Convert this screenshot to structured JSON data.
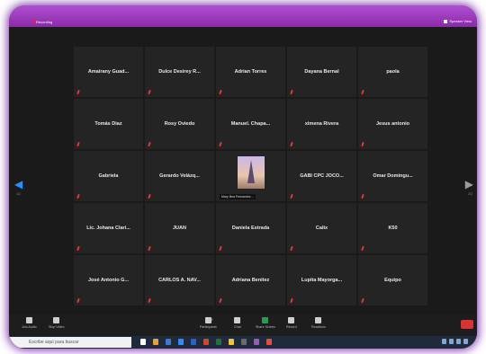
{
  "window": {
    "title": "Recording",
    "speaker_view": "Speaker View"
  },
  "participants": [
    {
      "name": "Amairany  Guad...",
      "muted": true
    },
    {
      "name": "Dulce Desirey R...",
      "muted": true
    },
    {
      "name": "Adrian Torres",
      "muted": true
    },
    {
      "name": "Dayana Bernal",
      "muted": true
    },
    {
      "name": "paola",
      "muted": true
    },
    {
      "name": "Tomás Diaz",
      "muted": true
    },
    {
      "name": "Rosy Oviedo",
      "muted": true
    },
    {
      "name": "Manuel.  Chapa...",
      "muted": true
    },
    {
      "name": "ximena Rivera",
      "muted": true
    },
    {
      "name": "Jesus antonio",
      "muted": true
    },
    {
      "name": "Gabriela",
      "muted": true
    },
    {
      "name": "Gerardo  Velázq...",
      "muted": true
    },
    {
      "name": "Mary Bea Fernandez...",
      "muted": false,
      "photo": true
    },
    {
      "name": "GABI CPC JOCO...",
      "muted": true
    },
    {
      "name": "Omar  Domingu...",
      "muted": true
    },
    {
      "name": "Lic. Johana Clari...",
      "muted": true
    },
    {
      "name": "JUAN",
      "muted": true
    },
    {
      "name": "Daniela Estrada",
      "muted": true
    },
    {
      "name": "Calix",
      "muted": true
    },
    {
      "name": "K50",
      "muted": true
    },
    {
      "name": "José Antonio G...",
      "muted": true
    },
    {
      "name": "CARLOS A. NAV...",
      "muted": true
    },
    {
      "name": "Adriana Benitez",
      "muted": true
    },
    {
      "name": "Lupita  Mayorga...",
      "muted": true
    },
    {
      "name": "Equipo",
      "muted": true
    }
  ],
  "pagination": {
    "left": "1/2",
    "right": "2/2"
  },
  "controls": {
    "audio": "Join Audio",
    "video": "Stop Video",
    "participants": "Participants",
    "participants_count": "25",
    "chat": "Chat",
    "share": "Share Screen",
    "record": "Record",
    "reactions": "Reactions"
  },
  "taskbar": {
    "search_placeholder": "Escribe aquí para buscar"
  },
  "colors": {
    "border_glow": "#8a2aa8",
    "share_green": "#1aa34a",
    "mute_red": "#e03a3a",
    "nav_blue": "#2d8cff"
  }
}
